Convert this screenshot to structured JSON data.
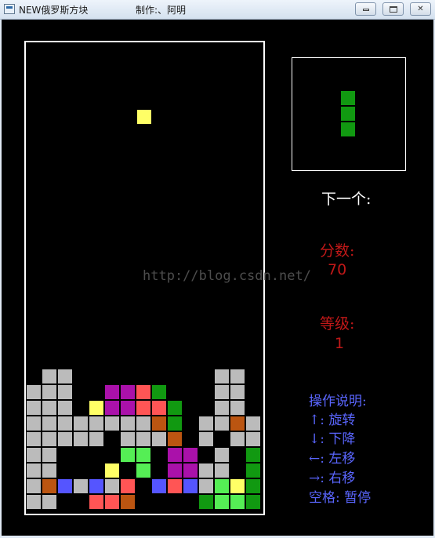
{
  "window": {
    "title": "NEW俄罗斯方块",
    "author": "制作:、阿明",
    "minimize_icon": "minimize-icon",
    "maximize_icon": "maximize-icon",
    "close_icon": "close-icon",
    "close_glyph": "✕"
  },
  "colors": {
    "Y": "#ffff66",
    "G": "#bbbbbb",
    "P": "#aa11aa",
    "R": "#ff5555",
    "D": "#119911",
    "O": "#bb5511",
    "B": "#5555ff",
    "L": "#55ee55",
    "background": "#000000",
    "red_text": "#c01818",
    "help_text": "#5a66ff"
  },
  "board": {
    "rows": 30,
    "cols": 15,
    "falling_piece": {
      "color": "Y",
      "cells": [
        [
          3,
          7
        ]
      ]
    },
    "grid": [
      "...............",
      "...............",
      "...............",
      "...............",
      "...............",
      "...............",
      "...............",
      "...............",
      "...............",
      "...............",
      "...............",
      "...............",
      "...............",
      "...............",
      "...............",
      "...............",
      "...............",
      "...............",
      "...............",
      "...............",
      "...............",
      ".GG.........GG.",
      "GGG..PPRD...GG.",
      "GGG.YPPRRD..GG.",
      "GGGGGGGGOD.GGOG",
      "GGGGG.GGGO.G.GG",
      "GG....LL.PP.G.D",
      "GG...Y.L.PPGG.D",
      "GOBGBGR.BRBGLYD",
      "GG..RRO....DLLD"
    ]
  },
  "next_piece": {
    "color": "D",
    "cells": [
      [
        0,
        0
      ],
      [
        1,
        0
      ],
      [
        2,
        0
      ]
    ]
  },
  "sidebar": {
    "next_label": "下一个:",
    "score_label": "分数:",
    "score_value": "70",
    "level_label": "等级:",
    "level_value": "1"
  },
  "help": {
    "title": "操作说明:",
    "lines": [
      "↑: 旋转",
      "↓: 下降",
      "←: 左移",
      "→: 右移",
      "空格: 暂停"
    ]
  },
  "watermark": "http://blog.csdn.net/"
}
